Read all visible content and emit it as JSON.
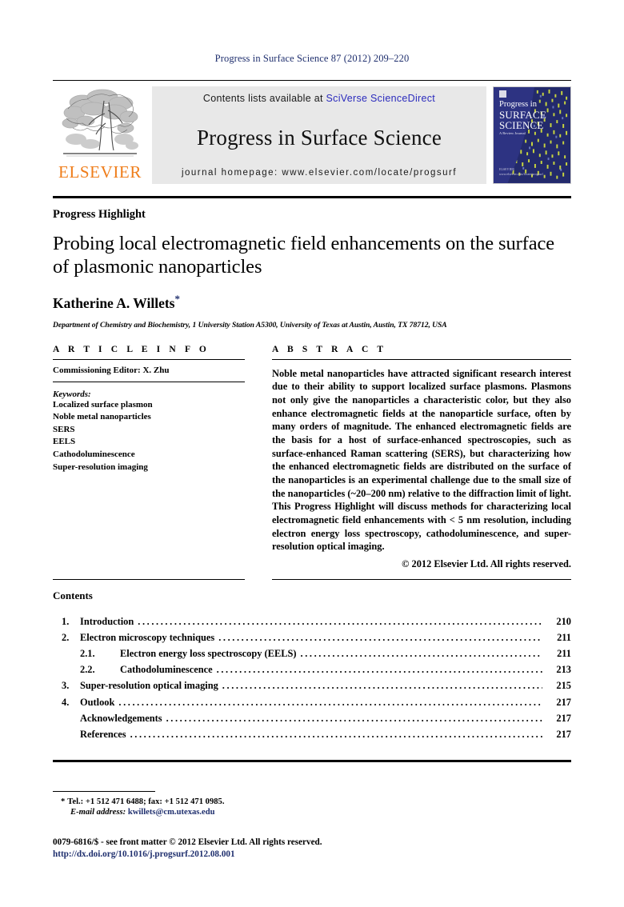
{
  "running_head": "Progress in Surface Science 87 (2012) 209–220",
  "masthead": {
    "publisher_name": "ELSEVIER",
    "contents_prefix": "Contents lists available at ",
    "sciencedirect": "SciVerse ScienceDirect",
    "journal_name": "Progress in Surface Science",
    "homepage": "journal homepage: www.elsevier.com/locate/progsurf",
    "cover": {
      "line1": "Progress in",
      "line2": "SURFACE",
      "line3": "SCIENCE",
      "line4": "A Review Journal",
      "foot1": "ELSEVIER",
      "foot2": "www.elsevier.com/locate/progsurf"
    },
    "colors": {
      "band_bg": "#e8e8e8",
      "sciencedirect": "#2b2bbd",
      "elsevier_orange": "#ef7d1a",
      "cover_bg": "#2d3382",
      "cover_accent": "#c9d63f"
    }
  },
  "article": {
    "kicker": "Progress Highlight",
    "title": "Probing local electromagnetic field enhancements on the surface of plasmonic nanoparticles",
    "author": "Katherine A. Willets",
    "author_marker": "*",
    "affiliation": "Department of Chemistry and Biochemistry, 1 University Station A5300, University of Texas at Austin, Austin, TX 78712, USA"
  },
  "article_info": {
    "heading": "A R T I C L E    I N F O",
    "editor": "Commissioning Editor: X. Zhu",
    "keywords_label": "Keywords:",
    "keywords": [
      "Localized surface plasmon",
      "Noble metal nanoparticles",
      "SERS",
      "EELS",
      "Cathodoluminescence",
      "Super-resolution imaging"
    ]
  },
  "abstract": {
    "heading": "A B S T R A C T",
    "body": "Noble metal nanoparticles have attracted significant research interest due to their ability to support localized surface plasmons. Plasmons not only give the nanoparticles a characteristic color, but they also enhance electromagnetic fields at the nanoparticle surface, often by many orders of magnitude. The enhanced electromagnetic fields are the basis for a host of surface-enhanced spectroscopies, such as surface-enhanced Raman scattering (SERS), but characterizing how the enhanced electromagnetic fields are distributed on the surface of the nanoparticles is an experimental challenge due to the small size of the nanoparticles (~20–200 nm) relative to the diffraction limit of light. This Progress Highlight will discuss methods for characterizing local electromagnetic field enhancements with < 5 nm resolution, including electron energy loss spectroscopy, cathodoluminescence, and super-resolution optical imaging.",
    "copyright": "© 2012 Elsevier Ltd. All rights reserved."
  },
  "contents": {
    "heading": "Contents",
    "items": [
      {
        "num": "1.",
        "sub": "",
        "label": "Introduction",
        "page": "210",
        "level": 1
      },
      {
        "num": "2.",
        "sub": "",
        "label": "Electron microscopy techniques",
        "page": "211",
        "level": 1
      },
      {
        "num": "",
        "sub": "2.1.",
        "label": "Electron energy loss spectroscopy (EELS)",
        "page": "211",
        "level": 2
      },
      {
        "num": "",
        "sub": "2.2.",
        "label": "Cathodoluminescence",
        "page": "213",
        "level": 2
      },
      {
        "num": "3.",
        "sub": "",
        "label": "Super-resolution optical imaging",
        "page": "215",
        "level": 1
      },
      {
        "num": "4.",
        "sub": "",
        "label": "Outlook",
        "page": "217",
        "level": 1
      },
      {
        "num": "",
        "sub": "",
        "label": "Acknowledgements",
        "page": "217",
        "level": 3
      },
      {
        "num": "",
        "sub": "",
        "label": "References",
        "page": "217",
        "level": 3
      }
    ]
  },
  "footnotes": {
    "marker": "*",
    "tel_fax": "Tel.: +1 512 471 6488; fax: +1 512 471 0985.",
    "email_label": "E-mail address:",
    "email": "kwillets@cm.utexas.edu",
    "issn": "0079-6816/$ - see front matter © 2012 Elsevier Ltd. All rights reserved.",
    "doi": "http://dx.doi.org/10.1016/j.progsurf.2012.08.001"
  }
}
